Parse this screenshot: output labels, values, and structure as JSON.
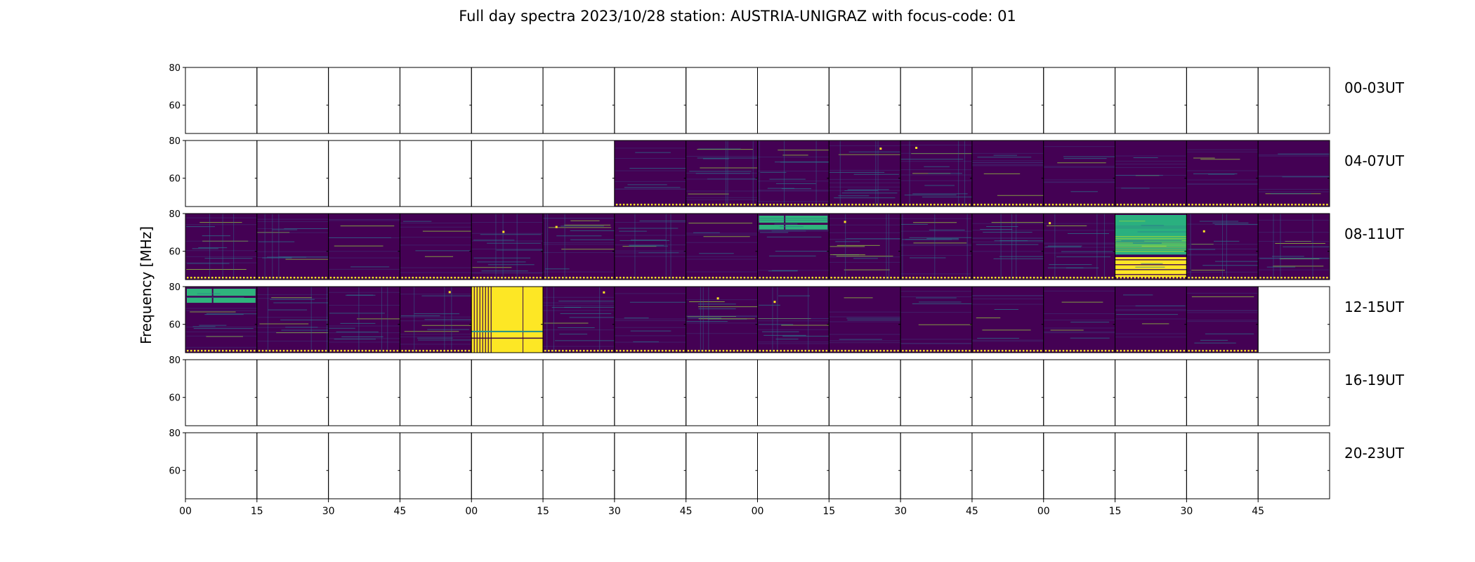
{
  "chart_data": {
    "type": "heatmap",
    "title": "Full day spectra 2023/10/28 station: AUSTRIA-UNIGRAZ with focus-code: 01",
    "ylabel": "Frequency [MHz]",
    "xlabel": "",
    "grid": false,
    "ylim": [
      45,
      80
    ],
    "ytick_labels": [
      "80",
      "60"
    ],
    "ytick_values": [
      80,
      60
    ],
    "xtick_labels": [
      "00",
      "15",
      "30",
      "45",
      "00",
      "15",
      "30",
      "45",
      "00",
      "15",
      "30",
      "45",
      "00",
      "15",
      "30",
      "45"
    ],
    "colormap": "viridis",
    "colors": {
      "low": "#440154",
      "mid": "#21908c",
      "high": "#fde725",
      "background": "#ffffff",
      "axes": "#000000"
    },
    "rows": [
      {
        "label": "00-03UT",
        "panels": [
          "none",
          "none",
          "none",
          "none",
          "none",
          "none",
          "none",
          "none",
          "none",
          "none",
          "none",
          "none",
          "none",
          "none",
          "none",
          "none"
        ]
      },
      {
        "label": "04-07UT",
        "panels": [
          "none",
          "none",
          "none",
          "none",
          "none",
          "none",
          "quiet",
          "rfi",
          "rfi",
          "rfi",
          "rfi",
          "quiet",
          "quiet",
          "quiet",
          "quiet",
          "quiet"
        ]
      },
      {
        "label": "08-11UT",
        "panels": [
          "rfi",
          "rfi",
          "quiet",
          "quiet",
          "rfi",
          "rfi",
          "rfi",
          "quiet",
          "bright_top",
          "rfi",
          "rfi",
          "rfi",
          "rfi",
          "burst",
          "rfi",
          "rfi"
        ]
      },
      {
        "label": "12-15UT",
        "panels": [
          "bright_top",
          "rfi",
          "rfi",
          "rfi",
          "saturated",
          "rfi",
          "quiet",
          "rfi",
          "rfi",
          "quiet",
          "quiet",
          "quiet",
          "quiet",
          "quiet",
          "quiet",
          "none"
        ]
      },
      {
        "label": "16-19UT",
        "panels": [
          "none",
          "none",
          "none",
          "none",
          "none",
          "none",
          "none",
          "none",
          "none",
          "none",
          "none",
          "none",
          "none",
          "none",
          "none",
          "none"
        ]
      },
      {
        "label": "20-23UT",
        "panels": [
          "none",
          "none",
          "none",
          "none",
          "none",
          "none",
          "none",
          "none",
          "none",
          "none",
          "none",
          "none",
          "none",
          "none",
          "none",
          "none"
        ]
      }
    ]
  }
}
